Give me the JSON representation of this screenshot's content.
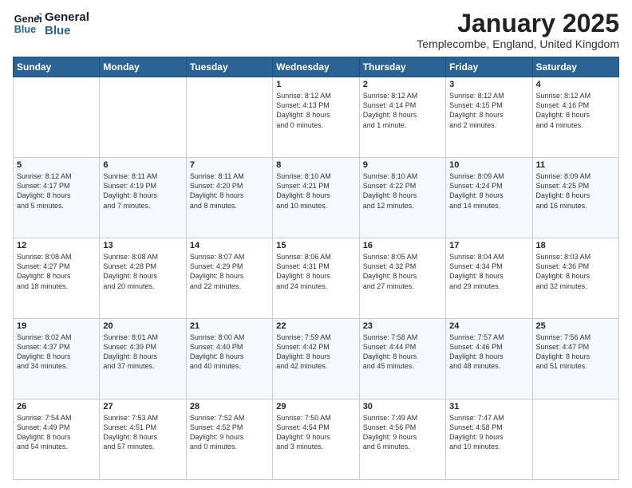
{
  "header": {
    "logo_line1": "General",
    "logo_line2": "Blue",
    "month": "January 2025",
    "location": "Templecombe, England, United Kingdom"
  },
  "days_of_week": [
    "Sunday",
    "Monday",
    "Tuesday",
    "Wednesday",
    "Thursday",
    "Friday",
    "Saturday"
  ],
  "weeks": [
    [
      {
        "day": "",
        "text": ""
      },
      {
        "day": "",
        "text": ""
      },
      {
        "day": "",
        "text": ""
      },
      {
        "day": "1",
        "text": "Sunrise: 8:12 AM\nSunset: 4:13 PM\nDaylight: 8 hours\nand 0 minutes."
      },
      {
        "day": "2",
        "text": "Sunrise: 8:12 AM\nSunset: 4:14 PM\nDaylight: 8 hours\nand 1 minute."
      },
      {
        "day": "3",
        "text": "Sunrise: 8:12 AM\nSunset: 4:15 PM\nDaylight: 8 hours\nand 2 minutes."
      },
      {
        "day": "4",
        "text": "Sunrise: 8:12 AM\nSunset: 4:16 PM\nDaylight: 8 hours\nand 4 minutes."
      }
    ],
    [
      {
        "day": "5",
        "text": "Sunrise: 8:12 AM\nSunset: 4:17 PM\nDaylight: 8 hours\nand 5 minutes."
      },
      {
        "day": "6",
        "text": "Sunrise: 8:11 AM\nSunset: 4:19 PM\nDaylight: 8 hours\nand 7 minutes."
      },
      {
        "day": "7",
        "text": "Sunrise: 8:11 AM\nSunset: 4:20 PM\nDaylight: 8 hours\nand 8 minutes."
      },
      {
        "day": "8",
        "text": "Sunrise: 8:10 AM\nSunset: 4:21 PM\nDaylight: 8 hours\nand 10 minutes."
      },
      {
        "day": "9",
        "text": "Sunrise: 8:10 AM\nSunset: 4:22 PM\nDaylight: 8 hours\nand 12 minutes."
      },
      {
        "day": "10",
        "text": "Sunrise: 8:09 AM\nSunset: 4:24 PM\nDaylight: 8 hours\nand 14 minutes."
      },
      {
        "day": "11",
        "text": "Sunrise: 8:09 AM\nSunset: 4:25 PM\nDaylight: 8 hours\nand 16 minutes."
      }
    ],
    [
      {
        "day": "12",
        "text": "Sunrise: 8:08 AM\nSunset: 4:27 PM\nDaylight: 8 hours\nand 18 minutes."
      },
      {
        "day": "13",
        "text": "Sunrise: 8:08 AM\nSunset: 4:28 PM\nDaylight: 8 hours\nand 20 minutes."
      },
      {
        "day": "14",
        "text": "Sunrise: 8:07 AM\nSunset: 4:29 PM\nDaylight: 8 hours\nand 22 minutes."
      },
      {
        "day": "15",
        "text": "Sunrise: 8:06 AM\nSunset: 4:31 PM\nDaylight: 8 hours\nand 24 minutes."
      },
      {
        "day": "16",
        "text": "Sunrise: 8:05 AM\nSunset: 4:32 PM\nDaylight: 8 hours\nand 27 minutes."
      },
      {
        "day": "17",
        "text": "Sunrise: 8:04 AM\nSunset: 4:34 PM\nDaylight: 8 hours\nand 29 minutes."
      },
      {
        "day": "18",
        "text": "Sunrise: 8:03 AM\nSunset: 4:36 PM\nDaylight: 8 hours\nand 32 minutes."
      }
    ],
    [
      {
        "day": "19",
        "text": "Sunrise: 8:02 AM\nSunset: 4:37 PM\nDaylight: 8 hours\nand 34 minutes."
      },
      {
        "day": "20",
        "text": "Sunrise: 8:01 AM\nSunset: 4:39 PM\nDaylight: 8 hours\nand 37 minutes."
      },
      {
        "day": "21",
        "text": "Sunrise: 8:00 AM\nSunset: 4:40 PM\nDaylight: 8 hours\nand 40 minutes."
      },
      {
        "day": "22",
        "text": "Sunrise: 7:59 AM\nSunset: 4:42 PM\nDaylight: 8 hours\nand 42 minutes."
      },
      {
        "day": "23",
        "text": "Sunrise: 7:58 AM\nSunset: 4:44 PM\nDaylight: 8 hours\nand 45 minutes."
      },
      {
        "day": "24",
        "text": "Sunrise: 7:57 AM\nSunset: 4:46 PM\nDaylight: 8 hours\nand 48 minutes."
      },
      {
        "day": "25",
        "text": "Sunrise: 7:56 AM\nSunset: 4:47 PM\nDaylight: 8 hours\nand 51 minutes."
      }
    ],
    [
      {
        "day": "26",
        "text": "Sunrise: 7:54 AM\nSunset: 4:49 PM\nDaylight: 8 hours\nand 54 minutes."
      },
      {
        "day": "27",
        "text": "Sunrise: 7:53 AM\nSunset: 4:51 PM\nDaylight: 8 hours\nand 57 minutes."
      },
      {
        "day": "28",
        "text": "Sunrise: 7:52 AM\nSunset: 4:52 PM\nDaylight: 9 hours\nand 0 minutes."
      },
      {
        "day": "29",
        "text": "Sunrise: 7:50 AM\nSunset: 4:54 PM\nDaylight: 9 hours\nand 3 minutes."
      },
      {
        "day": "30",
        "text": "Sunrise: 7:49 AM\nSunset: 4:56 PM\nDaylight: 9 hours\nand 6 minutes."
      },
      {
        "day": "31",
        "text": "Sunrise: 7:47 AM\nSunset: 4:58 PM\nDaylight: 9 hours\nand 10 minutes."
      },
      {
        "day": "",
        "text": ""
      }
    ]
  ]
}
